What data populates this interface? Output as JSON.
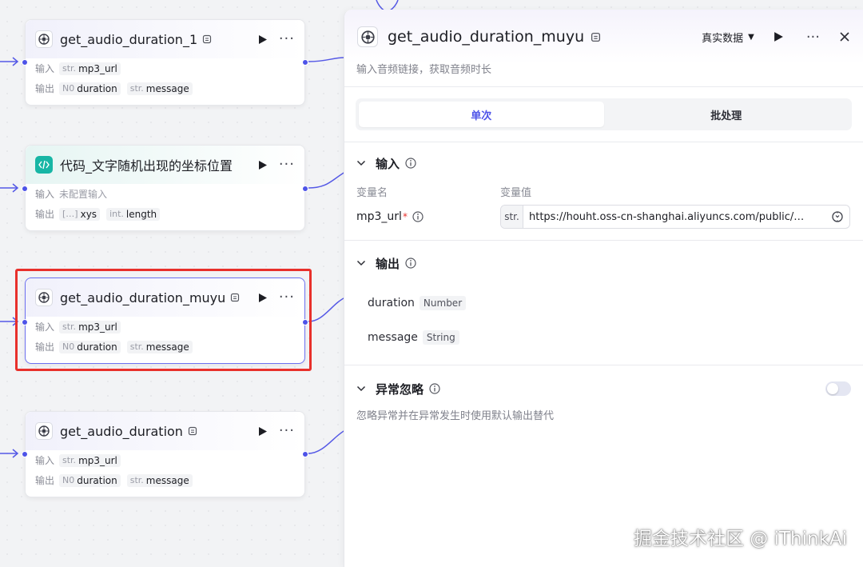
{
  "nodes": [
    {
      "title": "get_audio_duration_1",
      "input_label": "输入",
      "output_label": "输出",
      "inputs": [
        {
          "type": "str.",
          "name": "mp3_url"
        }
      ],
      "outputs": [
        {
          "type": "N0",
          "name": "duration"
        },
        {
          "type": "str.",
          "name": "message"
        }
      ]
    },
    {
      "title": "代码_文字随机出现的坐标位置",
      "input_label": "输入",
      "output_label": "输出",
      "input_empty": "未配置输入",
      "outputs": [
        {
          "type": "[…]",
          "name": "xys"
        },
        {
          "type": "int.",
          "name": "length"
        }
      ]
    },
    {
      "title": "get_audio_duration_muyu",
      "input_label": "输入",
      "output_label": "输出",
      "inputs": [
        {
          "type": "str.",
          "name": "mp3_url"
        }
      ],
      "outputs": [
        {
          "type": "N0",
          "name": "duration"
        },
        {
          "type": "str.",
          "name": "message"
        }
      ]
    },
    {
      "title": "get_audio_duration",
      "input_label": "输入",
      "output_label": "输出",
      "inputs": [
        {
          "type": "str.",
          "name": "mp3_url"
        }
      ],
      "outputs": [
        {
          "type": "N0",
          "name": "duration"
        },
        {
          "type": "str.",
          "name": "message"
        }
      ]
    }
  ],
  "panel": {
    "title": "get_audio_duration_muyu",
    "dataset": "真实数据",
    "description": "输入音频链接，获取音频时长",
    "tabs": [
      "单次",
      "批处理"
    ],
    "active_tab": "单次",
    "input_section": {
      "title": "输入",
      "col_name": "变量名",
      "col_value": "变量值",
      "var_name": "mp3_url",
      "required_mark": "*",
      "var_type": "str.",
      "var_value": "https://houht.oss-cn-shanghai.aliyuncs.com/public/…"
    },
    "output_section": {
      "title": "输出",
      "outputs": [
        {
          "name": "duration",
          "type": "Number"
        },
        {
          "name": "message",
          "type": "String"
        }
      ]
    },
    "ignore_section": {
      "title": "异常忽略",
      "description": "忽略异常并在异常发生时使用默认输出替代",
      "enabled": false
    }
  },
  "watermark": "掘金技术社区 @ iThinkAi",
  "colors": {
    "accent": "#4d53e8",
    "selection_highlight": "#e8302b",
    "code_icon": "#17b6a5"
  }
}
